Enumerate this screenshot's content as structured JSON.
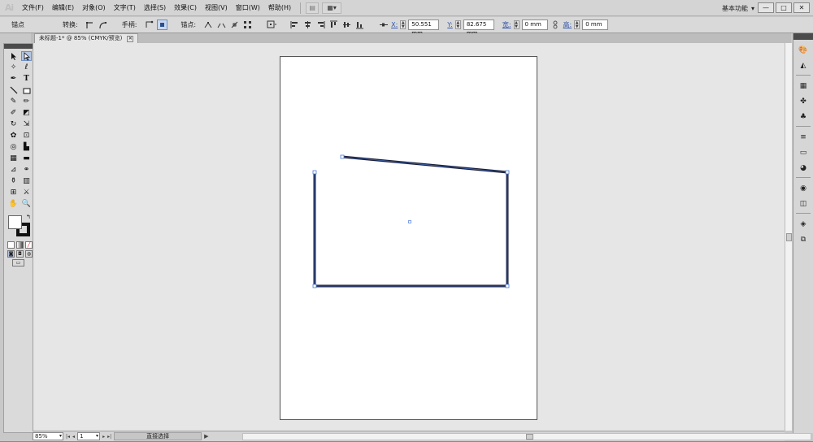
{
  "app": {
    "logo": "Ai",
    "menu": [
      "文件(F)",
      "编辑(E)",
      "对象(O)",
      "文字(T)",
      "选择(S)",
      "效果(C)",
      "视图(V)",
      "窗口(W)",
      "帮助(H)"
    ],
    "workspace": "基本功能",
    "workspace_arrow": "▾",
    "window_buttons": [
      "—",
      "□",
      "✕"
    ]
  },
  "control_bar": {
    "anchor_label": "锚点",
    "convert_label": "转换:",
    "handles_label": "手柄:",
    "anchors_label": "锚点:",
    "x_label": "X:",
    "x_value": "50.551 mm",
    "y_label": "Y:",
    "y_value": "82.675 mm",
    "w_label": "宽:",
    "w_value": "0 mm",
    "h_label": "高:",
    "h_value": "0 mm"
  },
  "document": {
    "tab_title": "未标题-1* @ 85% (CMYK/预览)",
    "close": "✕"
  },
  "status": {
    "zoom": "85%",
    "artboard_number": "1",
    "current_tool": "直接选择",
    "play": "▶"
  },
  "icons": {
    "selection": "selection-tool-icon",
    "direct_selection": "direct-selection-tool-icon",
    "pen": "pen-tool-icon",
    "type": "type-tool-icon"
  },
  "colors": {
    "stroke": "#1a1f3a",
    "selection_blue": "#4a7bd8",
    "panel_dark": "#4b4b4b"
  }
}
